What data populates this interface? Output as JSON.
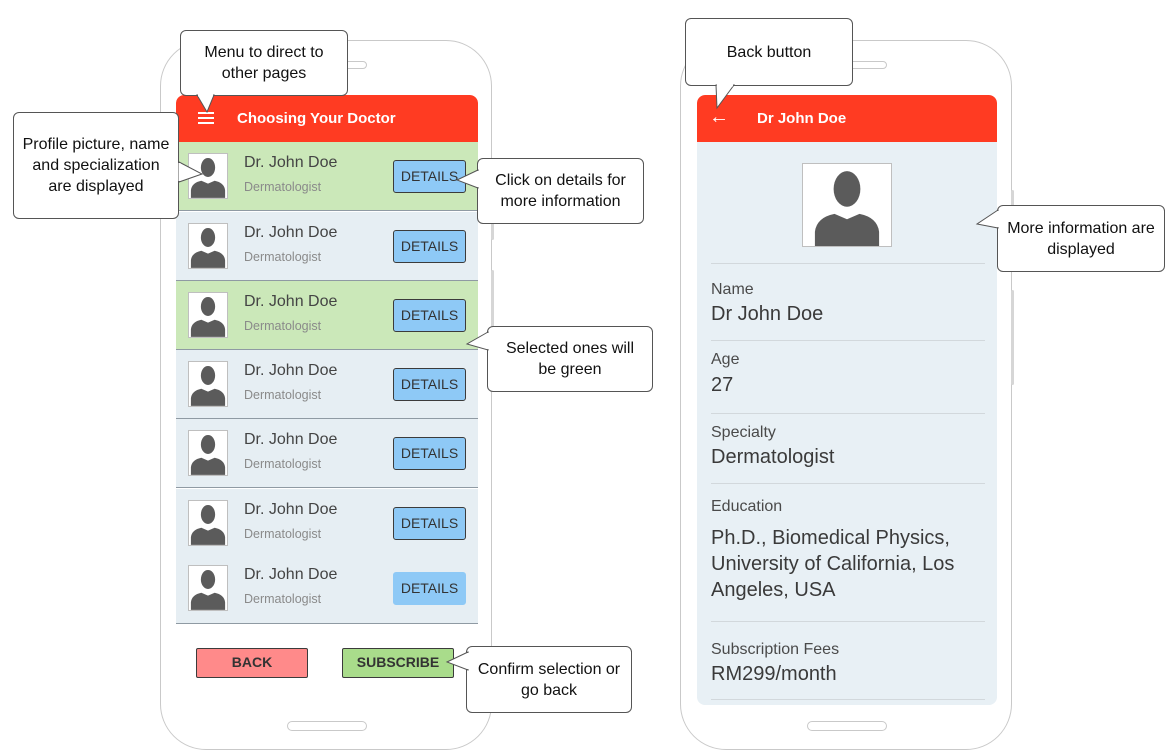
{
  "left_screen": {
    "appbar_title": "Choosing Your Doctor",
    "doctors": [
      {
        "name": "Dr. John Doe",
        "specialty": "Dermatologist",
        "details_label": "DETAILS",
        "selected": true
      },
      {
        "name": "Dr. John Doe",
        "specialty": "Dermatologist",
        "details_label": "DETAILS",
        "selected": false
      },
      {
        "name": "Dr. John Doe",
        "specialty": "Dermatologist",
        "details_label": "DETAILS",
        "selected": true
      },
      {
        "name": "Dr. John Doe",
        "specialty": "Dermatologist",
        "details_label": "DETAILS",
        "selected": false
      },
      {
        "name": "Dr. John Doe",
        "specialty": "Dermatologist",
        "details_label": "DETAILS",
        "selected": false
      },
      {
        "name": "Dr. John Doe",
        "specialty": "Dermatologist",
        "details_label": "DETAILS",
        "selected": false
      },
      {
        "name": "Dr. John Doe",
        "specialty": "Dermatologist",
        "details_label": "DETAILS",
        "selected": false
      }
    ],
    "back_label": "BACK",
    "subscribe_label": "SUBSCRIBE"
  },
  "right_screen": {
    "appbar_title": "Dr John Doe",
    "fields": {
      "name_label": "Name",
      "name_value": "Dr John Doe",
      "age_label": "Age",
      "age_value": "27",
      "specialty_label": "Specialty",
      "specialty_value": "Dermatologist",
      "education_label": "Education",
      "education_value": "Ph.D., Biomedical Physics, University of California, Los Angeles, USA",
      "fees_label": "Subscription Fees",
      "fees_value": "RM299/month"
    }
  },
  "callouts": {
    "menu": "Menu to direct to other pages",
    "profile": "Profile picture, name and specialization are displayed",
    "details": "Click on details for more information",
    "selected": "Selected ones will be green",
    "confirm": "Confirm selection or go back",
    "back_button": "Back button",
    "more_info": "More information are displayed"
  },
  "icons": {
    "menu": "hamburger-menu-icon",
    "back": "arrow-left-icon",
    "avatar": "person-silhouette-icon"
  },
  "colors": {
    "appbar": "#ff3b22",
    "selected_row": "#cbe8b9",
    "row": "#e6eef3",
    "details_button": "#8ec9f6",
    "back_button": "#ff8a8a",
    "subscribe_button": "#a9dc8b"
  }
}
